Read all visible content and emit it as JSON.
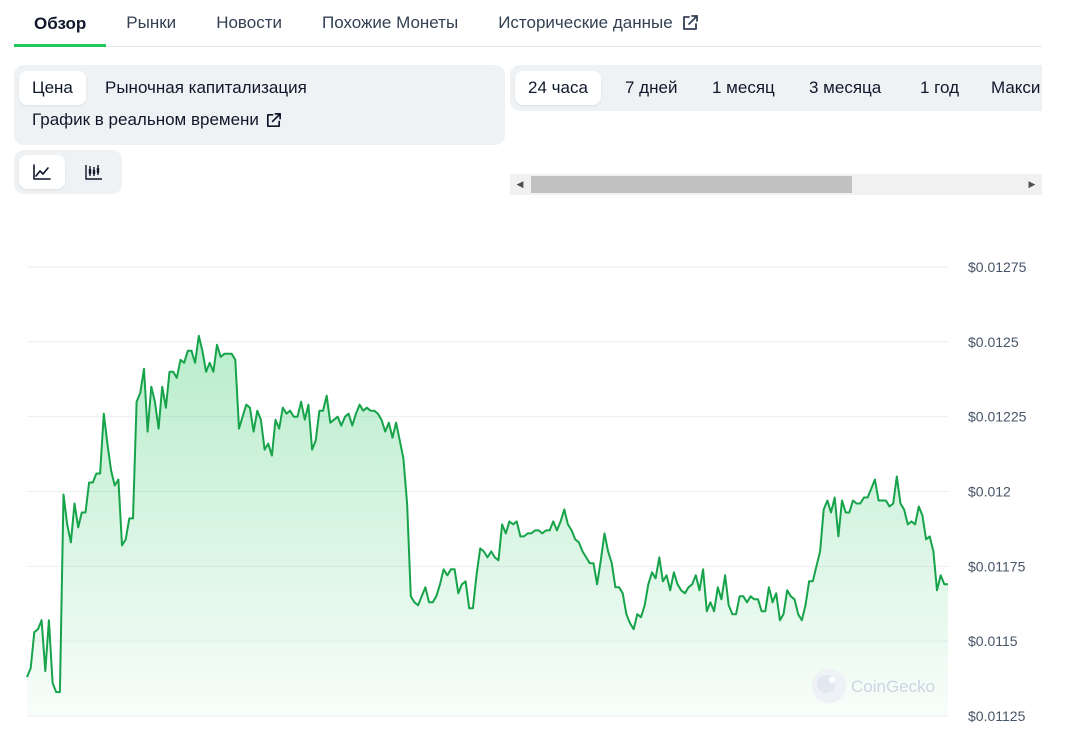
{
  "tabs": [
    {
      "label": "Обзор",
      "active": true
    },
    {
      "label": "Рынки"
    },
    {
      "label": "Новости"
    },
    {
      "label": "Похожие Монеты"
    },
    {
      "label": "Исторические данные",
      "external": true
    }
  ],
  "metric": {
    "price_label": "Цена",
    "market_cap_label": "Рыночная капитализация",
    "live_chart_label": "График в реальном времени"
  },
  "chart_types": [
    {
      "icon": "line-chart-icon",
      "active": true
    },
    {
      "icon": "candlestick-chart-icon",
      "active": false
    }
  ],
  "ranges": [
    "24 часа",
    "7 дней",
    "1 месяц",
    "3 месяца",
    "1 год",
    "Макси"
  ],
  "active_range": "24 часа",
  "colors": {
    "accent": "#22c55e",
    "line": "#16a34a",
    "grid": "#eceef1"
  },
  "watermark": "CoinGecko",
  "chart_data": {
    "type": "area",
    "ylim": [
      0.01125,
      0.0128
    ],
    "yticks": [
      {
        "value": 0.01275,
        "label": "$0.01275"
      },
      {
        "value": 0.0125,
        "label": "$0.0125"
      },
      {
        "value": 0.01225,
        "label": "$0.01225"
      },
      {
        "value": 0.012,
        "label": "$0.012"
      },
      {
        "value": 0.01175,
        "label": "$0.01175"
      },
      {
        "value": 0.0115,
        "label": "$0.0115"
      },
      {
        "value": 0.01125,
        "label": "$0.01125"
      }
    ],
    "values": [
      0.01138,
      0.01141,
      0.01153,
      0.01154,
      0.01157,
      0.0114,
      0.01157,
      0.01136,
      0.01133,
      0.01133,
      0.01199,
      0.01189,
      0.01183,
      0.01196,
      0.01188,
      0.01193,
      0.01193,
      0.01203,
      0.01203,
      0.01206,
      0.01206,
      0.01226,
      0.01216,
      0.01207,
      0.01202,
      0.01204,
      0.01182,
      0.01184,
      0.01191,
      0.01191,
      0.0123,
      0.01233,
      0.01241,
      0.0122,
      0.01235,
      0.0123,
      0.01221,
      0.01235,
      0.01228,
      0.0124,
      0.0124,
      0.01238,
      0.01244,
      0.01243,
      0.01247,
      0.01247,
      0.01243,
      0.01252,
      0.01247,
      0.0124,
      0.01243,
      0.0124,
      0.01249,
      0.01245,
      0.01246,
      0.01246,
      0.01246,
      0.01244,
      0.01221,
      0.01225,
      0.01229,
      0.01228,
      0.0122,
      0.01227,
      0.01224,
      0.01214,
      0.01216,
      0.01212,
      0.01224,
      0.01221,
      0.01228,
      0.01226,
      0.01227,
      0.01225,
      0.01225,
      0.0123,
      0.01224,
      0.01229,
      0.01214,
      0.01217,
      0.01227,
      0.01227,
      0.01232,
      0.01223,
      0.01224,
      0.01225,
      0.01222,
      0.01225,
      0.01226,
      0.01222,
      0.01226,
      0.01229,
      0.01227,
      0.01228,
      0.01227,
      0.01227,
      0.01226,
      0.01224,
      0.0122,
      0.01223,
      0.01218,
      0.01223,
      0.01217,
      0.01211,
      0.01196,
      0.01165,
      0.01163,
      0.01162,
      0.01165,
      0.01168,
      0.01163,
      0.01163,
      0.01165,
      0.01169,
      0.01174,
      0.01172,
      0.01174,
      0.01174,
      0.01166,
      0.01169,
      0.0117,
      0.01161,
      0.01161,
      0.01172,
      0.01181,
      0.0118,
      0.01178,
      0.0118,
      0.01178,
      0.01177,
      0.01189,
      0.01186,
      0.0119,
      0.01189,
      0.0119,
      0.01185,
      0.01185,
      0.01186,
      0.01186,
      0.01187,
      0.01187,
      0.01186,
      0.01187,
      0.01187,
      0.0119,
      0.01187,
      0.0119,
      0.01194,
      0.01189,
      0.01187,
      0.01184,
      0.01183,
      0.0118,
      0.01178,
      0.01176,
      0.01176,
      0.01169,
      0.01177,
      0.01186,
      0.0118,
      0.01176,
      0.01168,
      0.01168,
      0.01166,
      0.01159,
      0.01156,
      0.01154,
      0.01159,
      0.01158,
      0.01162,
      0.01169,
      0.01173,
      0.01171,
      0.01178,
      0.0117,
      0.01172,
      0.01167,
      0.01173,
      0.01169,
      0.01167,
      0.01166,
      0.01168,
      0.01169,
      0.01172,
      0.01167,
      0.01174,
      0.0116,
      0.01163,
      0.0116,
      0.01168,
      0.01164,
      0.01172,
      0.01162,
      0.01159,
      0.01159,
      0.01165,
      0.01165,
      0.01163,
      0.01165,
      0.01164,
      0.01164,
      0.0116,
      0.0116,
      0.01168,
      0.01163,
      0.01166,
      0.01157,
      0.01159,
      0.01167,
      0.01165,
      0.01164,
      0.01159,
      0.01157,
      0.01162,
      0.0117,
      0.0117,
      0.01175,
      0.0118,
      0.01194,
      0.01197,
      0.01193,
      0.01198,
      0.01185,
      0.01197,
      0.01193,
      0.01193,
      0.01197,
      0.01196,
      0.01196,
      0.01198,
      0.01198,
      0.01201,
      0.01204,
      0.01197,
      0.01197,
      0.01197,
      0.01195,
      0.01196,
      0.01205,
      0.01196,
      0.01194,
      0.01189,
      0.0119,
      0.01189,
      0.01195,
      0.01192,
      0.01184,
      0.01185,
      0.0118,
      0.01167,
      0.01172,
      0.01169,
      0.01169
    ]
  }
}
